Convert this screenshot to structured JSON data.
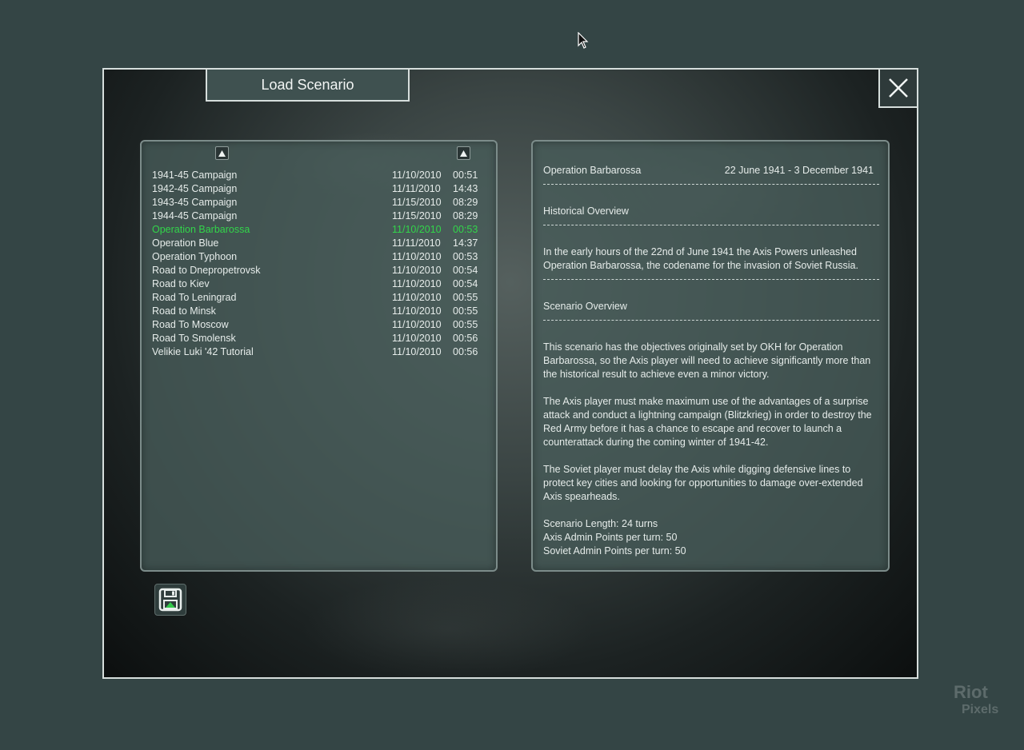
{
  "dialog": {
    "title": "Load Scenario",
    "close_label": "×"
  },
  "scenario_list": [
    {
      "name": "1941-45 Campaign",
      "date": "11/10/2010",
      "time": "00:51",
      "selected": false
    },
    {
      "name": "1942-45 Campaign",
      "date": "11/11/2010",
      "time": "14:43",
      "selected": false
    },
    {
      "name": "1943-45 Campaign",
      "date": "11/15/2010",
      "time": "08:29",
      "selected": false
    },
    {
      "name": "1944-45 Campaign",
      "date": "11/15/2010",
      "time": "08:29",
      "selected": false
    },
    {
      "name": "Operation Barbarossa",
      "date": "11/10/2010",
      "time": "00:53",
      "selected": true
    },
    {
      "name": "Operation Blue",
      "date": "11/11/2010",
      "time": "14:37",
      "selected": false
    },
    {
      "name": "Operation Typhoon",
      "date": "11/10/2010",
      "time": "00:53",
      "selected": false
    },
    {
      "name": "Road to Dnepropetrovsk",
      "date": "11/10/2010",
      "time": "00:54",
      "selected": false
    },
    {
      "name": "Road to Kiev",
      "date": "11/10/2010",
      "time": "00:54",
      "selected": false
    },
    {
      "name": "Road To Leningrad",
      "date": "11/10/2010",
      "time": "00:55",
      "selected": false
    },
    {
      "name": "Road to Minsk",
      "date": "11/10/2010",
      "time": "00:55",
      "selected": false
    },
    {
      "name": "Road To Moscow",
      "date": "11/10/2010",
      "time": "00:55",
      "selected": false
    },
    {
      "name": "Road To Smolensk",
      "date": "11/10/2010",
      "time": "00:56",
      "selected": false
    },
    {
      "name": "Velikie Luki '42 Tutorial",
      "date": "11/10/2010",
      "time": "00:56",
      "selected": false
    }
  ],
  "colors": {
    "selected_text": "#32d54a",
    "panel": "#485c5a",
    "background": "#344545"
  },
  "details": {
    "name": "Operation Barbarossa",
    "date_range": "22 June 1941 - 3 December 1941",
    "historical_heading": "Historical Overview",
    "historical_text": "In the early hours of the 22nd of June 1941 the Axis Powers unleashed Operation Barbarossa, the codename for the invasion of Soviet Russia.",
    "scenario_heading": "Scenario Overview",
    "paragraph1": "This scenario has the objectives originally set by OKH for Operation Barbarossa, so the Axis player will need to achieve significantly more than the historical result to achieve even a minor victory.",
    "paragraph2": "The Axis player must make maximum use of the advantages of a surprise attack and conduct a lightning campaign (Blitzkrieg) in order to destroy the Red Army before it has a chance to escape and recover to launch a counterattack during the coming winter of 1941-42.",
    "paragraph3": "The Soviet player must delay the Axis while digging defensive lines to protect key cities and looking for opportunities to damage over-extended Axis spearheads.",
    "length": "Scenario Length: 24 turns",
    "axis_admin": "Axis Admin Points per turn: 50",
    "soviet_admin": "Soviet Admin Points per turn: 50"
  },
  "icons": {
    "close": "close-icon",
    "sort": "triangle-up-icon",
    "load": "floppy-disk-icon"
  },
  "watermark": {
    "line1": "Riot",
    "line2": "Pixels"
  }
}
